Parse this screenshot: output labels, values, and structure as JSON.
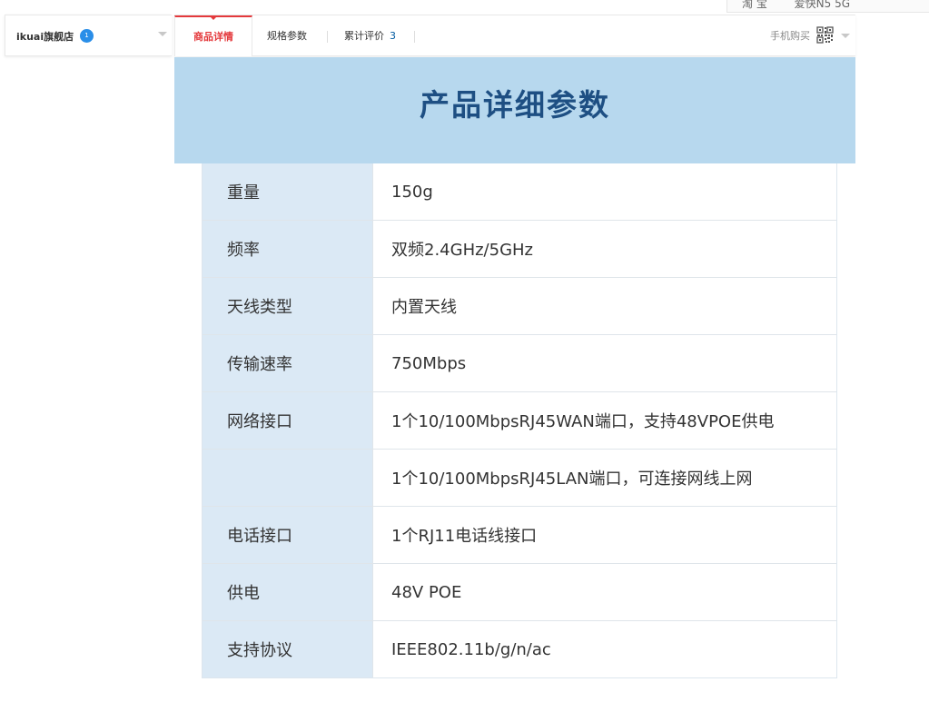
{
  "top_fragment": {
    "left": "淘 宝",
    "right": "爱快N5 5G"
  },
  "store": {
    "name": "ikuai旗舰店",
    "badge": "1"
  },
  "tabs": [
    {
      "label": "商品详情"
    },
    {
      "label": "规格参数"
    },
    {
      "label": "累计评价",
      "count": "3"
    }
  ],
  "mobile_buy": {
    "label": "手机购买"
  },
  "banner": {
    "title": "产品详细参数"
  },
  "specs": [
    {
      "label": "重量",
      "value": "150g"
    },
    {
      "label": "频率",
      "value": "双频2.4GHz/5GHz"
    },
    {
      "label": "天线类型",
      "value": "内置天线"
    },
    {
      "label": "传输速率",
      "value": "750Mbps"
    },
    {
      "label": "网络接口",
      "value": "1个10/100MbpsRJ45WAN端口，支持48VPOE供电"
    },
    {
      "label": "",
      "value": "1个10/100MbpsRJ45LAN端口，可连接网线上网"
    },
    {
      "label": "电话接口",
      "value": "1个RJ11电话线接口"
    },
    {
      "label": "供电",
      "value": "48V POE"
    },
    {
      "label": "支持协议",
      "value": "IEEE802.11b/g/n/ac"
    }
  ],
  "colors": {
    "accent": "#e4393c",
    "banner_bg": "#b7d8ee",
    "banner_title": "#1e4f83",
    "label_bg": "#dbe9f5"
  }
}
